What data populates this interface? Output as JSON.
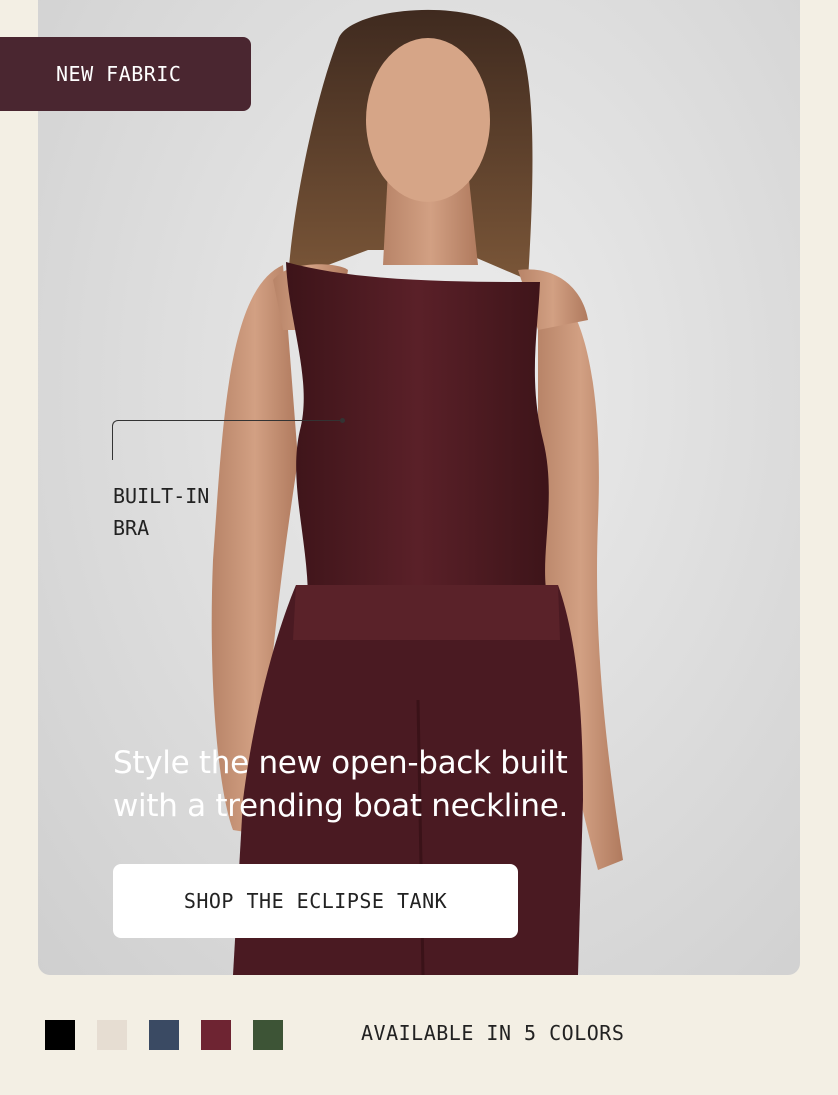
{
  "badge": {
    "label": "NEW FABRIC"
  },
  "callout": {
    "line1": "BUILT-IN",
    "line2": "BRA"
  },
  "headline": {
    "line1": "Style the new open-back built",
    "line2": "with a trending boat neckline."
  },
  "cta": {
    "label": "SHOP THE ECLIPSE TANK"
  },
  "colors": {
    "label": "AVAILABLE IN 5 COLORS",
    "swatches": [
      {
        "name": "black",
        "hex": "#000000"
      },
      {
        "name": "cream",
        "hex": "#e6ddd2"
      },
      {
        "name": "navy",
        "hex": "#3a4a63"
      },
      {
        "name": "burgundy",
        "hex": "#6e2432"
      },
      {
        "name": "olive",
        "hex": "#3d5436"
      }
    ]
  }
}
